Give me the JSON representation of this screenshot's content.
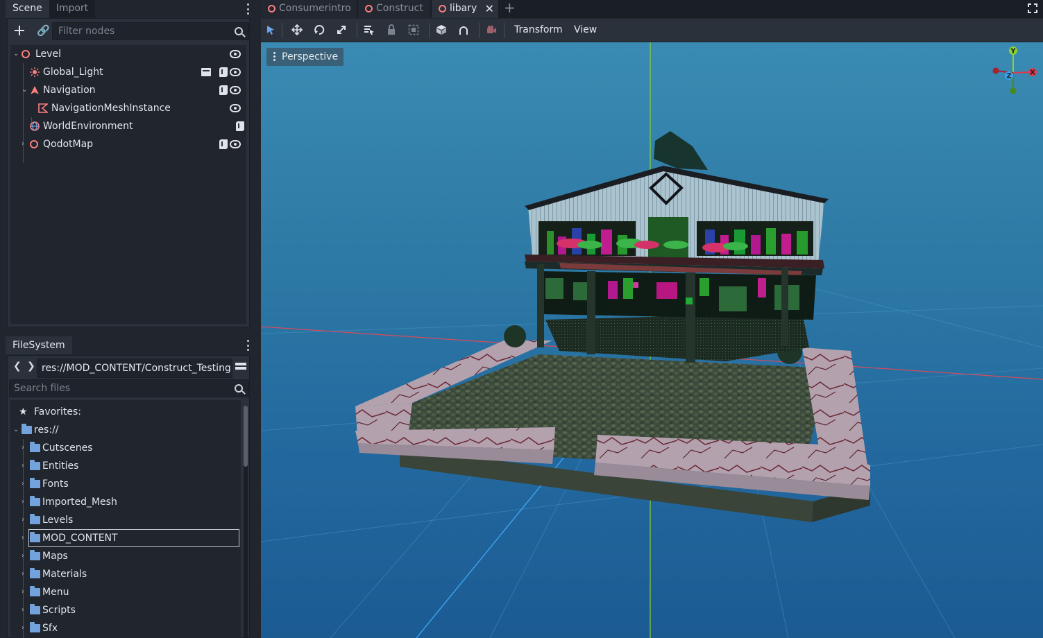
{
  "scene_dock": {
    "tabs": [
      "Scene",
      "Import"
    ],
    "filter_placeholder": "Filter nodes",
    "nodes": [
      {
        "label": "Level",
        "icon": "node3d-icon"
      },
      {
        "label": "Global_Light",
        "icon": "light-icon"
      },
      {
        "label": "Navigation",
        "icon": "navigation-icon"
      },
      {
        "label": "NavigationMeshInstance",
        "icon": "navmesh-icon"
      },
      {
        "label": "WorldEnvironment",
        "icon": "world-environment-icon"
      },
      {
        "label": "QodotMap",
        "icon": "node3d-icon"
      }
    ]
  },
  "filesystem_dock": {
    "tab": "FileSystem",
    "path": "res://MOD_CONTENT/Construct_Testing",
    "search_placeholder": "Search files",
    "favorites_label": "Favorites:",
    "root_label": "res://",
    "folders": [
      "Cutscenes",
      "Entities",
      "Fonts",
      "Imported_Mesh",
      "Levels",
      "MOD_CONTENT",
      "Maps",
      "Materials",
      "Menu",
      "Scripts",
      "Sfx"
    ],
    "selected_folder": "MOD_CONTENT"
  },
  "editor_tabs": [
    {
      "label": "Consumerintro",
      "active": false
    },
    {
      "label": "Construct",
      "active": false
    },
    {
      "label": "libary",
      "active": true
    }
  ],
  "viewport_toolbar": {
    "menus": [
      "Transform",
      "View"
    ]
  },
  "viewport": {
    "perspective_label": "Perspective",
    "gizmo": {
      "y": "Y",
      "x": "X",
      "z": "Z"
    }
  },
  "colors": {
    "node_accent": "#fc7f7f",
    "folder": "#72a3dd",
    "select_tool": "#6fa6f0",
    "axis_x": "#e0394d",
    "axis_y": "#8bd12c",
    "axis_z": "#3da3ee"
  }
}
